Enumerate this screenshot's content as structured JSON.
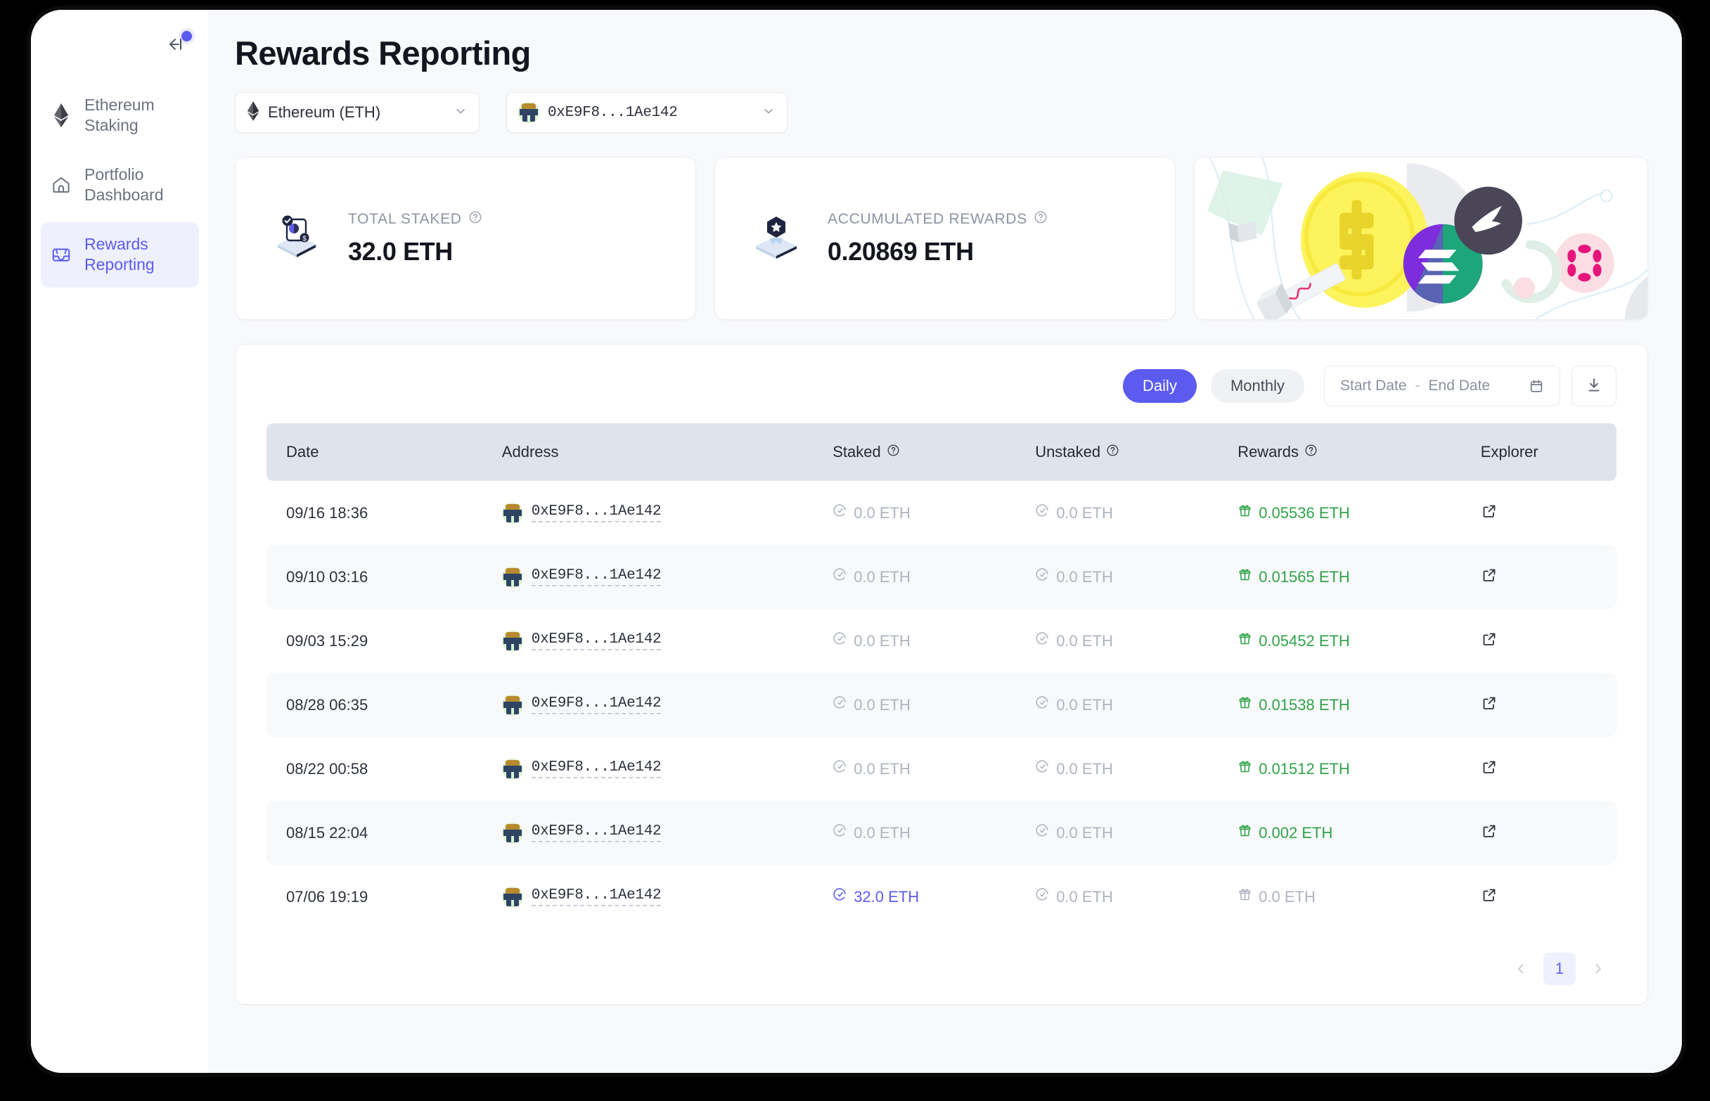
{
  "sidebar": {
    "collapse_icon": "collapse-left-icon",
    "notification_dot": true,
    "items": [
      {
        "label": "Ethereum Staking",
        "icon": "ethereum-icon",
        "active": false
      },
      {
        "label": "Portfolio Dashboard",
        "icon": "home-icon",
        "active": false
      },
      {
        "label": "Rewards Reporting",
        "icon": "inbox-tray-icon",
        "active": true
      }
    ]
  },
  "page": {
    "title": "Rewards Reporting"
  },
  "filters": {
    "network": {
      "label": "Ethereum (ETH)",
      "icon": "ethereum-icon"
    },
    "address": {
      "label": "0xE9F8...1Ae142",
      "icon": "wallet-avatar"
    }
  },
  "stats": [
    {
      "label": "TOTAL STAKED",
      "value": "32.0 ETH",
      "icon": "staked-box-icon",
      "help": "help-circle-icon"
    },
    {
      "label": "ACCUMULATED REWARDS",
      "value": "0.20869 ETH",
      "icon": "rewards-badge-icon",
      "help": "help-circle-icon"
    }
  ],
  "toolbar": {
    "daily_label": "Daily",
    "monthly_label": "Monthly",
    "active_period": "Daily",
    "start_date_placeholder": "Start Date",
    "date_separator": "-",
    "end_date_placeholder": "End Date",
    "calendar_icon": "calendar-icon",
    "download_icon": "download-icon"
  },
  "table": {
    "columns": [
      {
        "label": "Date",
        "help": false
      },
      {
        "label": "Address",
        "help": false
      },
      {
        "label": "Staked",
        "help": true
      },
      {
        "label": "Unstaked",
        "help": true
      },
      {
        "label": "Rewards",
        "help": true
      },
      {
        "label": "Explorer",
        "help": false
      }
    ],
    "rows": [
      {
        "date": "09/16 18:36",
        "address": "0xE9F8...1Ae142",
        "staked": "0.0 ETH",
        "staked_state": "zero",
        "unstaked": "0.0 ETH",
        "unstaked_state": "zero",
        "rewards": "0.05536 ETH",
        "rewards_state": "green",
        "explorer": "external-link-icon"
      },
      {
        "date": "09/10 03:16",
        "address": "0xE9F8...1Ae142",
        "staked": "0.0 ETH",
        "staked_state": "zero",
        "unstaked": "0.0 ETH",
        "unstaked_state": "zero",
        "rewards": "0.01565 ETH",
        "rewards_state": "green",
        "explorer": "external-link-icon"
      },
      {
        "date": "09/03 15:29",
        "address": "0xE9F8...1Ae142",
        "staked": "0.0 ETH",
        "staked_state": "zero",
        "unstaked": "0.0 ETH",
        "unstaked_state": "zero",
        "rewards": "0.05452 ETH",
        "rewards_state": "green",
        "explorer": "external-link-icon"
      },
      {
        "date": "08/28 06:35",
        "address": "0xE9F8...1Ae142",
        "staked": "0.0 ETH",
        "staked_state": "zero",
        "unstaked": "0.0 ETH",
        "unstaked_state": "zero",
        "rewards": "0.01538 ETH",
        "rewards_state": "green",
        "explorer": "external-link-icon"
      },
      {
        "date": "08/22 00:58",
        "address": "0xE9F8...1Ae142",
        "staked": "0.0 ETH",
        "staked_state": "zero",
        "unstaked": "0.0 ETH",
        "unstaked_state": "zero",
        "rewards": "0.01512 ETH",
        "rewards_state": "green",
        "explorer": "external-link-icon"
      },
      {
        "date": "08/15 22:04",
        "address": "0xE9F8...1Ae142",
        "staked": "0.0 ETH",
        "staked_state": "zero",
        "unstaked": "0.0 ETH",
        "unstaked_state": "zero",
        "rewards": "0.002 ETH",
        "rewards_state": "green",
        "explorer": "external-link-icon"
      },
      {
        "date": "07/06 19:19",
        "address": "0xE9F8...1Ae142",
        "staked": "32.0 ETH",
        "staked_state": "purple",
        "unstaked": "0.0 ETH",
        "unstaked_state": "zero",
        "rewards": "0.0 ETH",
        "rewards_state": "zero",
        "explorer": "external-link-icon"
      }
    ]
  },
  "pagination": {
    "prev_icon": "chevron-left-icon",
    "next_icon": "chevron-right-icon",
    "current_page": "1"
  },
  "colors": {
    "accent": "#5b5bef",
    "accent_soft": "#eef0fe",
    "green": "#31a34a",
    "muted": "#aeb4c0",
    "table_header_bg": "#dfe3ec",
    "page_bg": "#f8f9fb"
  }
}
